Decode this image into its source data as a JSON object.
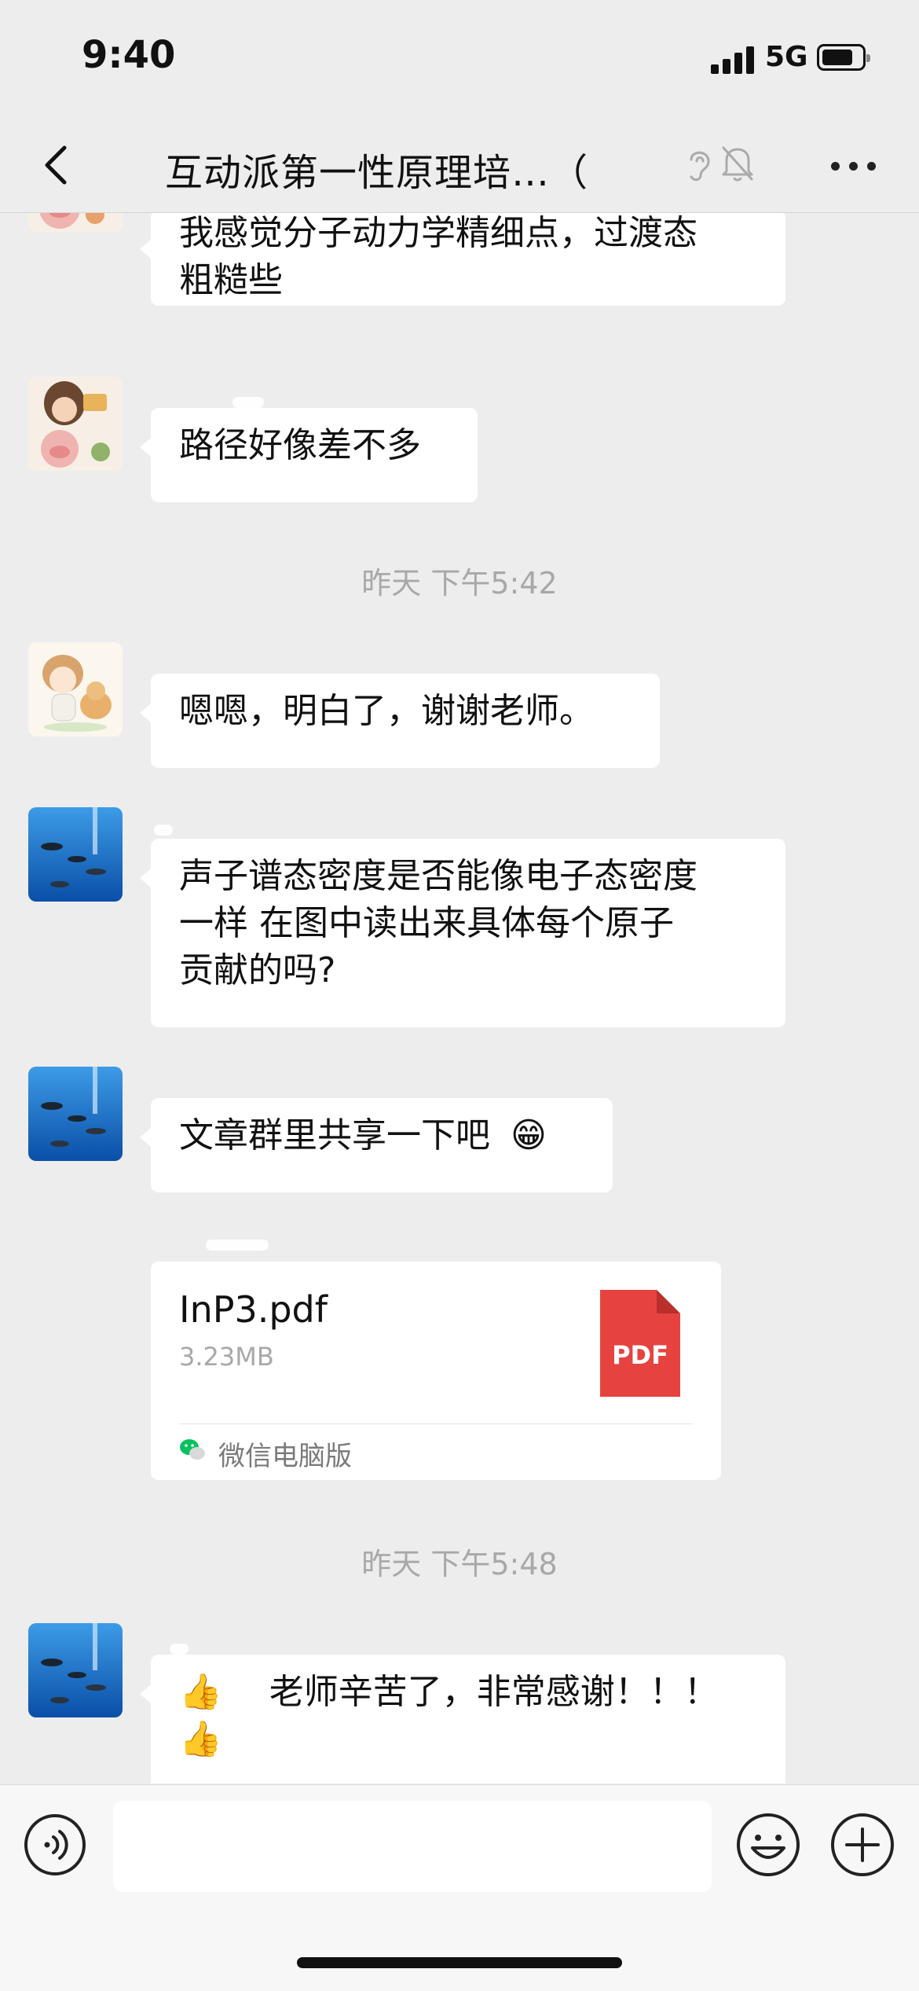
{
  "status_bar": {
    "time": "9:40",
    "network": "5G",
    "icons": [
      "signal-icon",
      "battery-icon"
    ]
  },
  "header": {
    "title": "互动派第一性原理培…（",
    "icons": [
      "back-icon",
      "ear-icon",
      "mute-icon",
      "more-icon"
    ]
  },
  "messages": [
    {
      "type": "text",
      "sender_avatar": "cartoon-girl-orange",
      "text_lines": [
        "我感觉分子动力学精细点，过渡态",
        "粗糙些"
      ]
    },
    {
      "type": "text",
      "sender_avatar": "cartoon-girl-orange",
      "text_lines": [
        "路径好像差不多"
      ]
    },
    {
      "type": "time",
      "text": "昨天 下午5:42"
    },
    {
      "type": "text",
      "sender_avatar": "cartoon-girl-cat",
      "text_lines": [
        "嗯嗯，明白了，谢谢老师。"
      ]
    },
    {
      "type": "text",
      "sender_avatar": "fish-tank",
      "text_lines": [
        "声子谱态密度是否能像电子态密度",
        "一样 在图中读出来具体每个原子",
        "贡献的吗?"
      ]
    },
    {
      "type": "text",
      "sender_avatar": "fish-tank",
      "text": "文章群里共享一下吧",
      "emoji": "😁"
    },
    {
      "type": "file",
      "file_name": "InP3.pdf",
      "file_size": "3.23MB",
      "file_badge": "PDF",
      "source": "微信电脑版"
    },
    {
      "type": "time",
      "text": "昨天 下午5:48"
    },
    {
      "type": "text",
      "sender_avatar": "fish-tank",
      "emoji": "👍",
      "text": "老师辛苦了，非常感谢！！！"
    }
  ],
  "input_bar": {
    "placeholder": "",
    "icons": [
      "voice-icon",
      "emoji-icon",
      "plus-icon"
    ]
  },
  "colors": {
    "background": "#ededed",
    "bubble": "#ffffff",
    "pdf_red": "#e64340",
    "wechat_green": "#07c160",
    "timestamp": "#a8a8a8"
  }
}
